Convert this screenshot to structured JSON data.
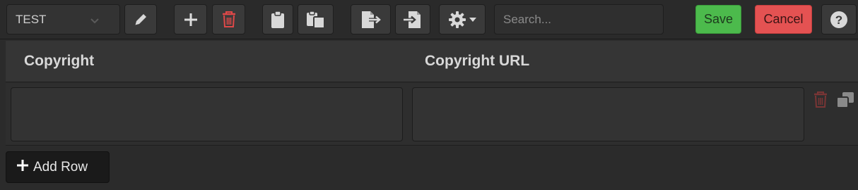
{
  "toolbar": {
    "preset_value": "TEST",
    "search_placeholder": "Search...",
    "save_label": "Save",
    "cancel_label": "Cancel",
    "icons": [
      "edit-icon",
      "plus-icon",
      "trash-icon",
      "clipboard-icon",
      "paste-icon",
      "export-icon",
      "import-icon",
      "gear-icon",
      "help-icon"
    ]
  },
  "table": {
    "columns": [
      "Copyright",
      "Copyright URL"
    ],
    "rows": [
      {
        "copyright": "",
        "copyright_url": ""
      }
    ]
  },
  "add_row_label": "Add Row",
  "colors": {
    "background": "#2b2b2b",
    "save": "#4cba4c",
    "cancel": "#e45252",
    "danger_icon": "#e04848",
    "row_delete_icon": "#7a3535"
  }
}
